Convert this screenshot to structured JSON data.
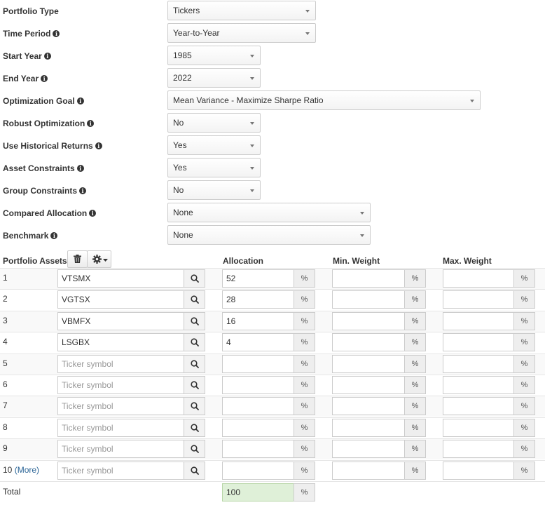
{
  "settings": [
    {
      "key": "portfolio_type",
      "label": "Portfolio Type",
      "info": false,
      "value": "Tickers",
      "width": "md"
    },
    {
      "key": "time_period",
      "label": "Time Period",
      "info": true,
      "value": "Year-to-Year",
      "width": "md"
    },
    {
      "key": "start_year",
      "label": "Start Year",
      "info": true,
      "value": "1985",
      "width": "sm"
    },
    {
      "key": "end_year",
      "label": "End Year",
      "info": true,
      "value": "2022",
      "width": "sm"
    },
    {
      "key": "optimization_goal",
      "label": "Optimization Goal",
      "info": true,
      "value": "Mean Variance - Maximize Sharpe Ratio",
      "width": "xl"
    },
    {
      "key": "robust_optimization",
      "label": "Robust Optimization",
      "info": true,
      "value": "No",
      "width": "sm"
    },
    {
      "key": "use_historical_returns",
      "label": "Use Historical Returns",
      "info": true,
      "value": "Yes",
      "width": "sm"
    },
    {
      "key": "asset_constraints",
      "label": "Asset Constraints",
      "info": true,
      "value": "Yes",
      "width": "sm"
    },
    {
      "key": "group_constraints",
      "label": "Group Constraints",
      "info": true,
      "value": "No",
      "width": "sm"
    },
    {
      "key": "compared_allocation",
      "label": "Compared Allocation",
      "info": true,
      "value": "None",
      "width": "lg"
    },
    {
      "key": "benchmark",
      "label": "Benchmark",
      "info": true,
      "value": "None",
      "width": "lg"
    }
  ],
  "assets_table": {
    "title": "Portfolio Assets",
    "col_allocation": "Allocation",
    "col_min_weight": "Min. Weight",
    "col_max_weight": "Max. Weight",
    "ticker_placeholder": "Ticker symbol",
    "percent_sign": "%",
    "more_link": "(More)",
    "rows": [
      {
        "num": "1",
        "ticker": "VTSMX",
        "allocation": "52",
        "min": "",
        "max": ""
      },
      {
        "num": "2",
        "ticker": "VGTSX",
        "allocation": "28",
        "min": "",
        "max": ""
      },
      {
        "num": "3",
        "ticker": "VBMFX",
        "allocation": "16",
        "min": "",
        "max": ""
      },
      {
        "num": "4",
        "ticker": "LSGBX",
        "allocation": "4",
        "min": "",
        "max": ""
      },
      {
        "num": "5",
        "ticker": "",
        "allocation": "",
        "min": "",
        "max": ""
      },
      {
        "num": "6",
        "ticker": "",
        "allocation": "",
        "min": "",
        "max": ""
      },
      {
        "num": "7",
        "ticker": "",
        "allocation": "",
        "min": "",
        "max": ""
      },
      {
        "num": "8",
        "ticker": "",
        "allocation": "",
        "min": "",
        "max": ""
      },
      {
        "num": "9",
        "ticker": "",
        "allocation": "",
        "min": "",
        "max": ""
      },
      {
        "num": "10",
        "ticker": "",
        "allocation": "",
        "min": "",
        "max": ""
      }
    ],
    "total_label": "Total",
    "total_value": "100"
  },
  "colors": {
    "total_bg": "#dff0d8",
    "link": "#2a6496"
  }
}
